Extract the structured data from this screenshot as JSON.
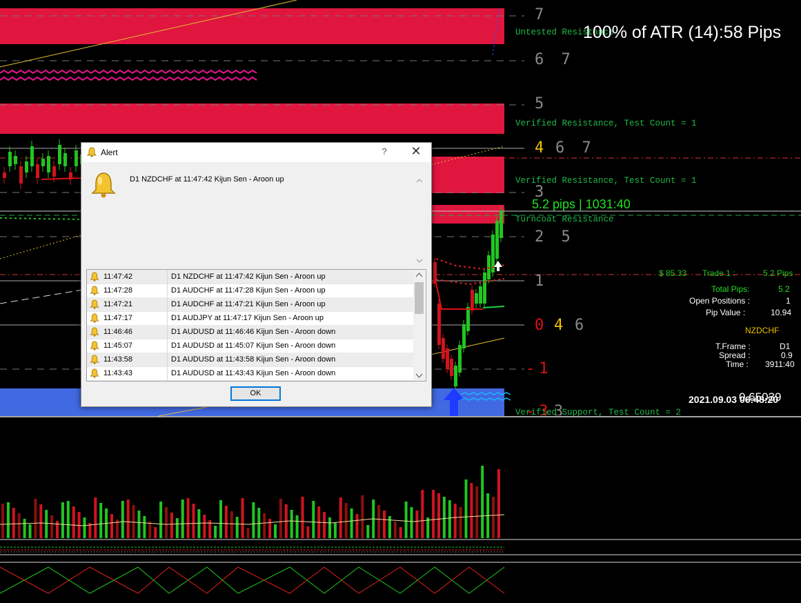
{
  "chart": {
    "atr_text": "100% of ATR (14):58 Pips",
    "pips_timer": "5.2 pips | 1031:40",
    "price": "0.65039",
    "datetime": "2021.09.03 06:48:20",
    "level_labels": {
      "l7": "7",
      "l67": "6 7",
      "l5": "5",
      "l467_a": "4",
      "l467_b": "6 7",
      "l3": "3",
      "l25": "2 5",
      "l1": "1",
      "l046_a": "0",
      "l046_b": "4",
      "l046_c": "6",
      "lm1": "-1",
      "lm3": "-3",
      "lm3b": "3"
    },
    "zones": {
      "untested": "Untested Resistance",
      "verified1": "Verified Resistance, Test Count = 1",
      "verified2": "Verified Resistance, Test Count = 1",
      "turncoat": "Turncoat Resistance",
      "support": "Verified Support, Test Count = 2"
    },
    "trade": {
      "pnl": "$ 85.33",
      "label": "Trade 1 :",
      "pips": "5.2 Pips"
    },
    "panel": {
      "total_pips_label": "Total Pips:",
      "total_pips": "5.2",
      "open_positions_label": "Open Positions :",
      "open_positions": "1",
      "pip_value_label": "Pip Value :",
      "pip_value": "10.94",
      "symbol": "NZDCHF",
      "tframe_label": "T.Frame :",
      "tframe": "D1",
      "spread_label": "Spread :",
      "spread": "0.9",
      "time_label": "Time :",
      "time": "3911:40"
    },
    "colors": {
      "resistance": "#e0163f",
      "support": "#4169e1",
      "bull": "#22c522",
      "bear": "#d0141e",
      "zone_text": "#1fb84a"
    }
  },
  "alert": {
    "title": "Alert",
    "help": "?",
    "close": "✕",
    "message": "D1 NZDCHF at 11:47:42 Kijun Sen - Aroon up",
    "ok_label": "OK",
    "rows": [
      {
        "time": "11:47:42",
        "msg": "D1 NZDCHF at 11:47:42 Kijun Sen - Aroon up"
      },
      {
        "time": "11:47:28",
        "msg": "D1 AUDCHF at 11:47:28 Kijun Sen - Aroon up"
      },
      {
        "time": "11:47:21",
        "msg": "D1 AUDCHF at 11:47:21 Kijun Sen - Aroon up"
      },
      {
        "time": "11:47:17",
        "msg": "D1 AUDJPY at 11:47:17 Kijun Sen - Aroon up"
      },
      {
        "time": "11:46:46",
        "msg": "D1 AUDUSD at 11:46:46 Kijun Sen - Aroon down"
      },
      {
        "time": "11:45:07",
        "msg": "D1 AUDUSD at 11:45:07 Kijun Sen - Aroon down"
      },
      {
        "time": "11:43:58",
        "msg": "D1 AUDUSD at 11:43:58 Kijun Sen - Aroon down"
      },
      {
        "time": "11:43:43",
        "msg": "D1 AUDUSD at 11:43:43 Kijun Sen - Aroon down"
      }
    ]
  }
}
